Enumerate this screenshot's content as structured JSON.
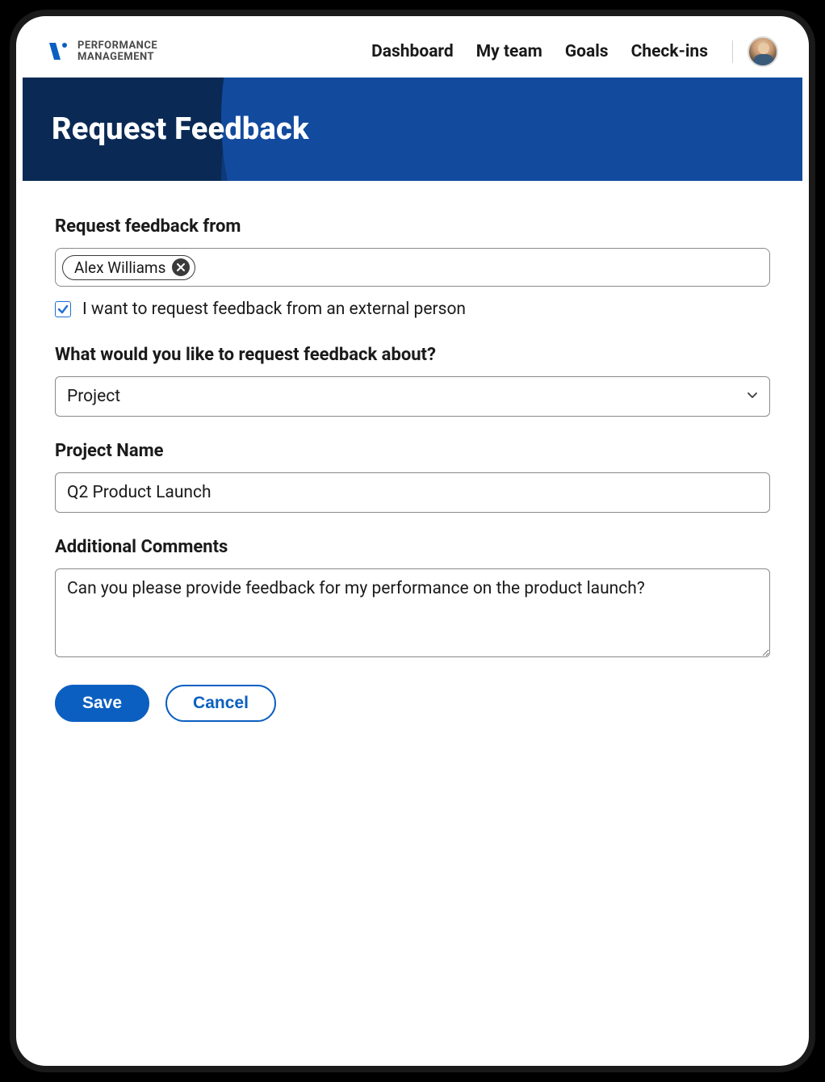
{
  "brand": {
    "line1": "PERFORMANCE",
    "line2": "MANAGEMENT"
  },
  "nav": {
    "dashboard": "Dashboard",
    "my_team": "My team",
    "goals": "Goals",
    "checkins": "Check-ins"
  },
  "hero": {
    "title": "Request Feedback"
  },
  "form": {
    "feedback_from_label": "Request feedback from",
    "chip": {
      "name": "Alex Williams"
    },
    "external_checkbox": {
      "checked": true,
      "label": "I want to request feedback from an external person"
    },
    "topic_label": "What would you like to request feedback about?",
    "topic_value": "Project",
    "project_name_label": "Project Name",
    "project_name_value": "Q2 Product Launch",
    "comments_label": "Additional Comments",
    "comments_value": "Can you please provide feedback for my performance on the product launch?",
    "buttons": {
      "save": "Save",
      "cancel": "Cancel"
    }
  }
}
